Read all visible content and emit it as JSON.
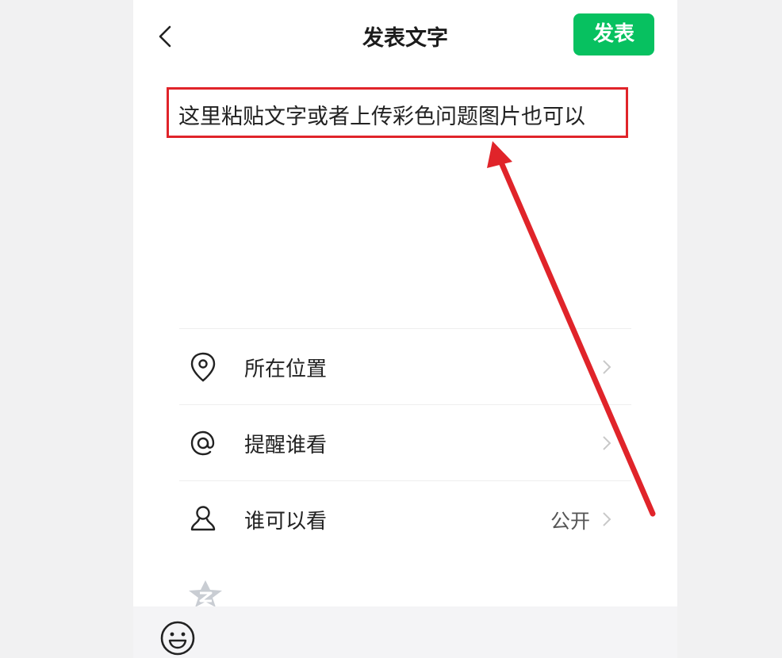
{
  "header": {
    "title": "发表文字",
    "post_label": "发表"
  },
  "compose": {
    "text": "这里粘贴文字或者上传彩色问题图片也可以"
  },
  "options": [
    {
      "label": "所在位置",
      "value": "",
      "icon": "location-pin-icon"
    },
    {
      "label": "提醒谁看",
      "value": "",
      "icon": "at-sign-icon"
    },
    {
      "label": "谁可以看",
      "value": "公开",
      "icon": "person-icon"
    }
  ],
  "colors": {
    "accent": "#07c160",
    "annotation": "#e0242a"
  }
}
